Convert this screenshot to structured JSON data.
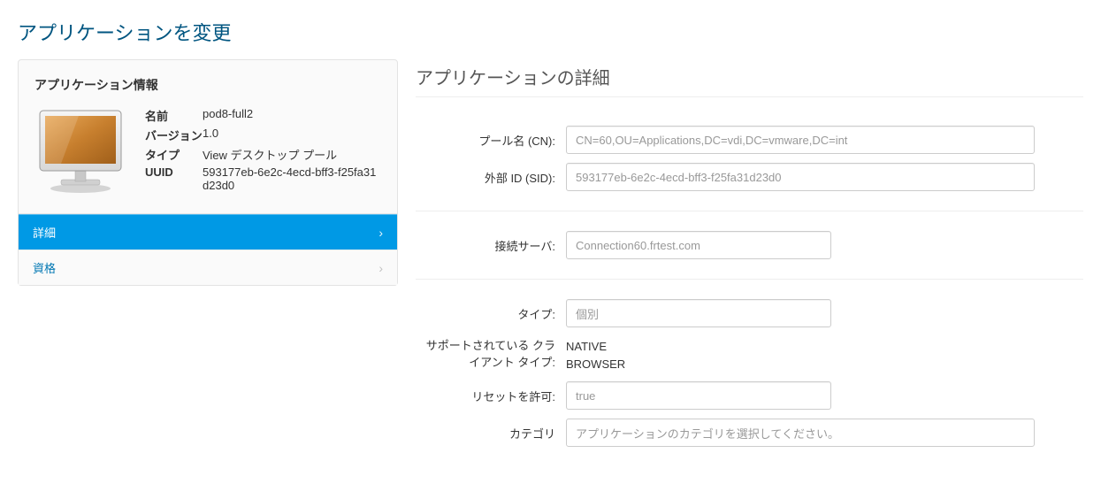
{
  "page": {
    "title": "アプリケーションを変更"
  },
  "info_panel": {
    "title": "アプリケーション情報",
    "labels": {
      "name": "名前",
      "version": "バージョン",
      "type": "タイプ",
      "uuid": "UUID"
    },
    "values": {
      "name": "pod8-full2",
      "version": "1.0",
      "type": "View デスクトップ プール",
      "uuid": "593177eb-6e2c-4ecd-bff3-f25fa31d23d0"
    }
  },
  "nav": {
    "details": "詳細",
    "entitlements": "資格"
  },
  "details": {
    "section_title": "アプリケーションの詳細",
    "labels": {
      "pool_cn": "プール名 (CN):",
      "external_id": "外部 ID (SID):",
      "connection_server": "接続サーバ:",
      "type": "タイプ:",
      "supported_client_type": "サポートされている クライアント タイプ:",
      "allow_reset": "リセットを許可:",
      "category": "カテゴリ"
    },
    "values": {
      "pool_cn": "CN=60,OU=Applications,DC=vdi,DC=vmware,DC=int",
      "external_id": "593177eb-6e2c-4ecd-bff3-f25fa31d23d0",
      "connection_server": "Connection60.frtest.com",
      "type": "個別",
      "supported_client_type_1": "NATIVE",
      "supported_client_type_2": "BROWSER",
      "allow_reset": "true",
      "category_placeholder": "アプリケーションのカテゴリを選択してください。"
    }
  }
}
